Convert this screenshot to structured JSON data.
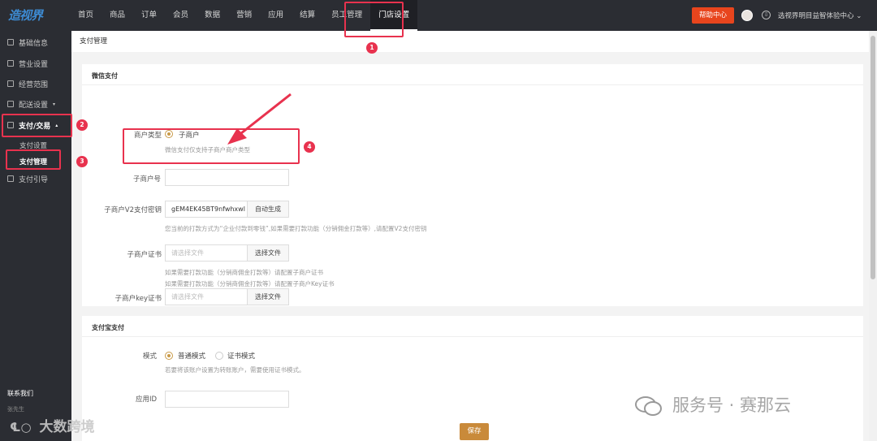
{
  "app": {
    "logo": "造视界"
  },
  "nav": [
    "首页",
    "商品",
    "订单",
    "会员",
    "数据",
    "营销",
    "应用",
    "结算",
    "员工管理",
    "门店设置"
  ],
  "header": {
    "help": "帮助中心",
    "account": "选视界明目益智体验中心",
    "account_caret": "⌄",
    "download_glyph": "⇩"
  },
  "sidebar": {
    "items": [
      {
        "label": "基础信息"
      },
      {
        "label": "营业设置"
      },
      {
        "label": "经营范围"
      },
      {
        "label": "配送设置",
        "caret": "▾"
      },
      {
        "label": "支付/交易",
        "caret": "▴"
      }
    ],
    "sub": [
      "支付设置",
      "支付管理"
    ],
    "after": "支付引导",
    "contact_title": "联系我们",
    "contact_name": "张先生"
  },
  "page": {
    "title": "支付管理"
  },
  "wechat": {
    "title": "微信支付",
    "merchant_type_label": "商户类型",
    "merchant_type_value": "子商户",
    "merchant_type_help": "微信支付仅支持子商户商户类型",
    "sub_mch_label": "子商户号",
    "sub_mch_value": "",
    "v2_key_label": "子商户V2支付密钥",
    "v2_key_value": "gEM4EK45BT9nfwhxwl",
    "v2_key_btn": "自动生成",
    "v2_key_help": "您当前的打款方式为“企业付款到零钱”,如果需要打款功能（分销佣金打款等）,请配置V2支付密钥",
    "cert_label": "子商户证书",
    "cert_placeholder": "请选择文件",
    "cert_btn": "选择文件",
    "cert_help": "如果需要打款功能（分销商佣金打款等）请配置子商户证书",
    "key_cert_label": "子商户key证书",
    "key_cert_placeholder": "请选择文件",
    "key_cert_btn": "选择文件",
    "key_cert_help": "如果需要打款功能（分销商佣金打款等）请配置子商户Key证书"
  },
  "alipay": {
    "title": "支付宝支付",
    "mode_label": "模式",
    "mode_options": [
      "普通模式",
      "证书模式"
    ],
    "mode_help": "若要将该账户设置为转账账户，需要使用证书模式。",
    "appid_label": "应用ID",
    "appid_value": ""
  },
  "save": "保存",
  "annotations": [
    "1",
    "2",
    "3",
    "4"
  ],
  "watermark": {
    "text": "服务号 · 赛那云",
    "brand": "大数跨境"
  },
  "colors": {
    "accent": "#c98a3a",
    "annotation": "#e8324e",
    "help_btn": "#e8451d",
    "nav_bg": "#2b2d33"
  }
}
